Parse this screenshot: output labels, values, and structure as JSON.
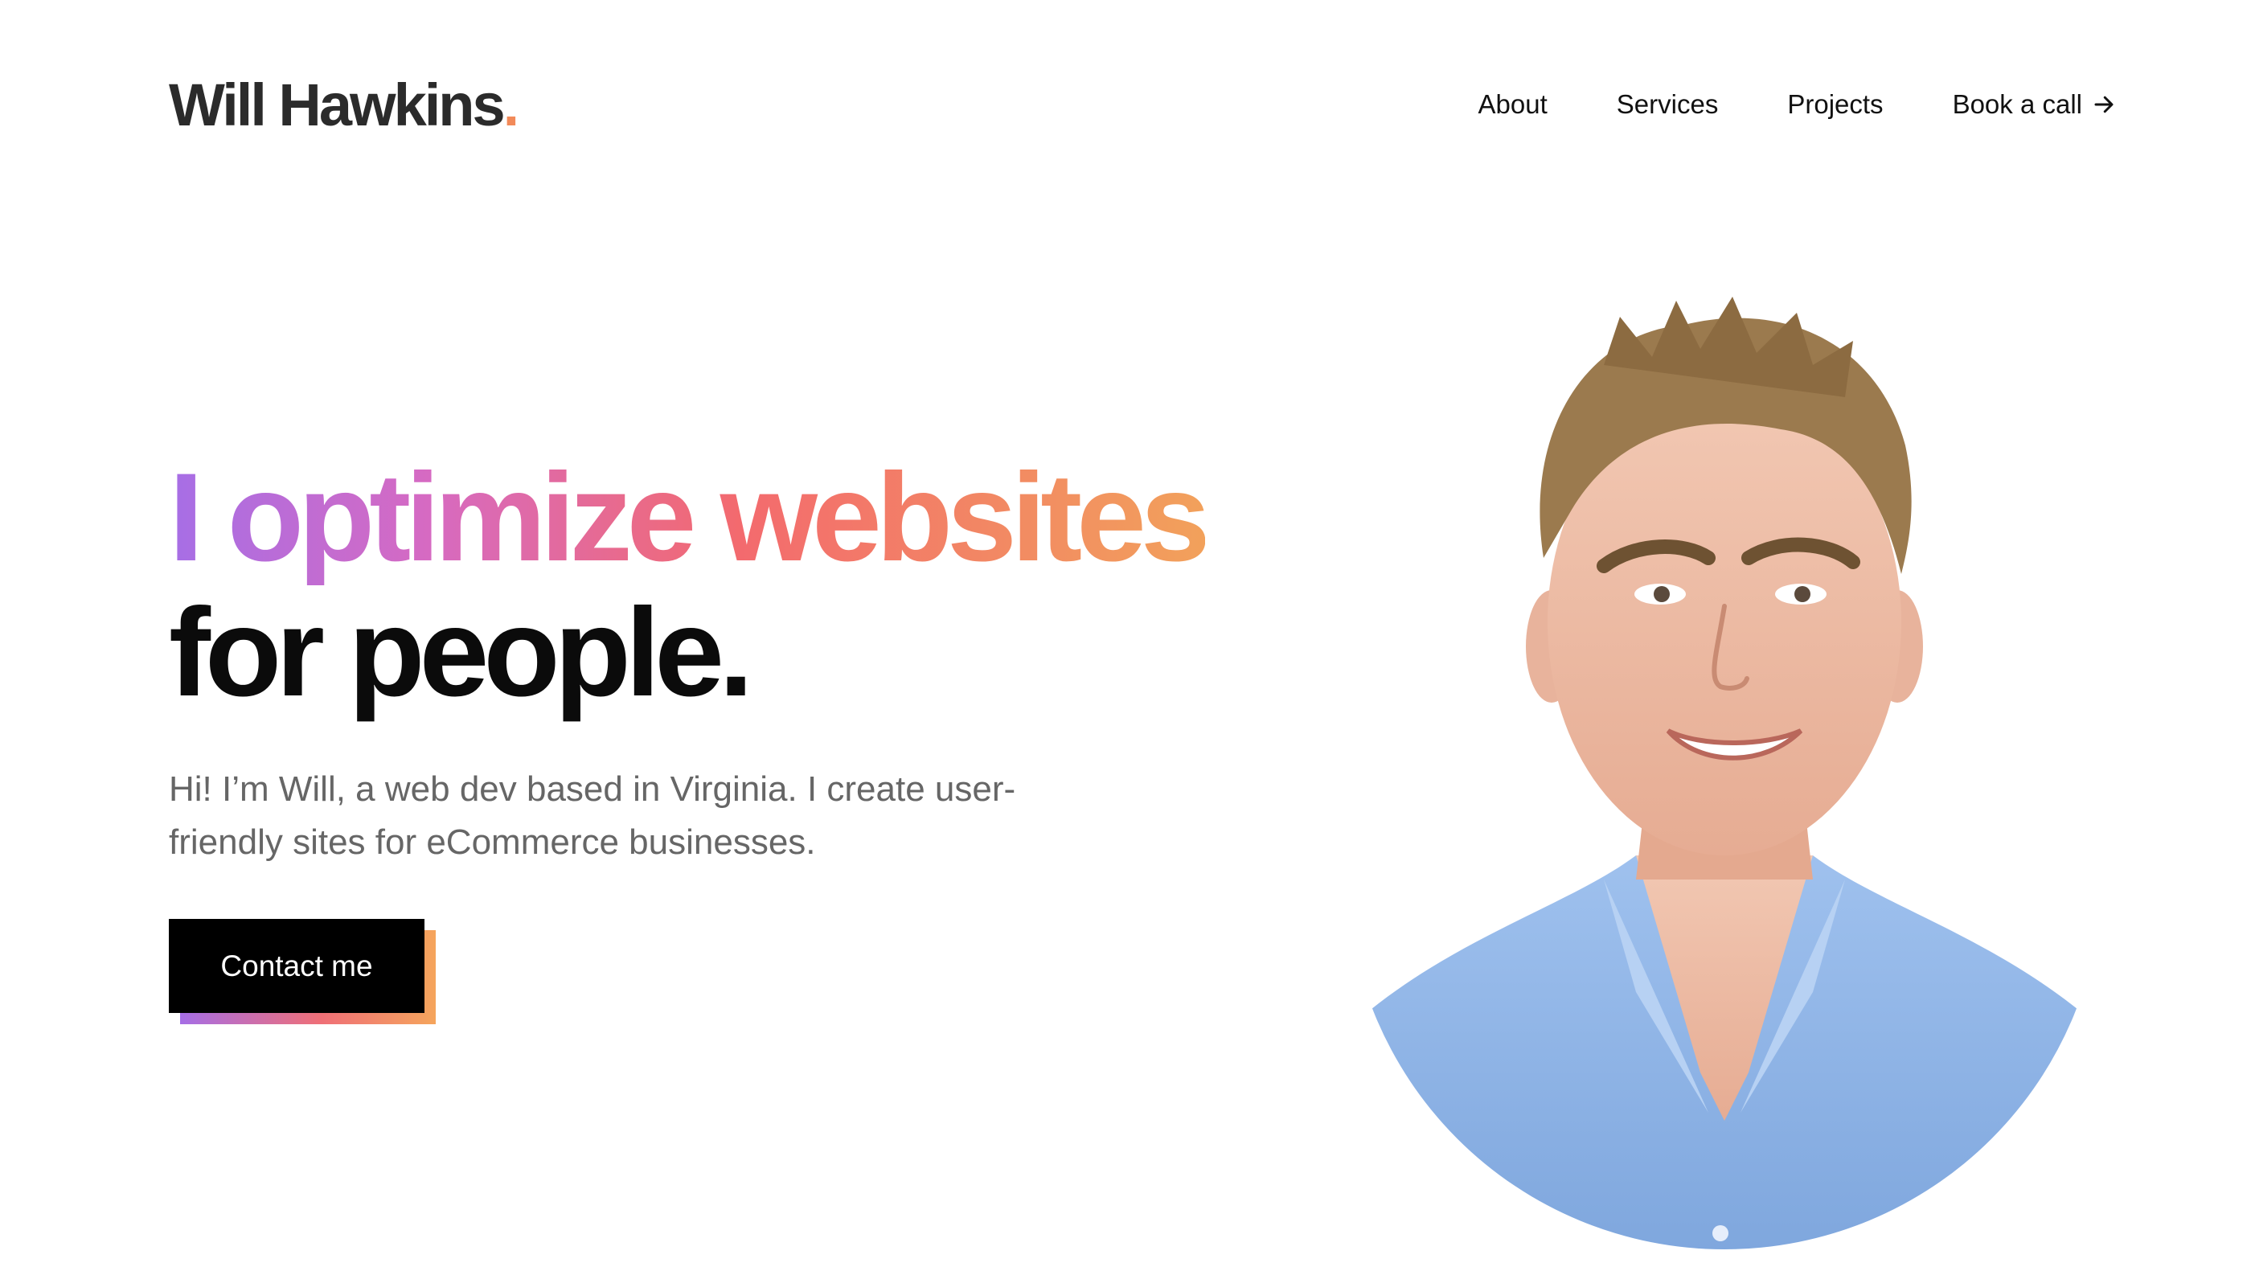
{
  "header": {
    "logo_text": "Will Hawkins",
    "logo_dot": "."
  },
  "nav": {
    "about": "About",
    "services": "Services",
    "projects": "Projects",
    "book_call": "Book a call",
    "book_call_icon": "arrow-right-icon"
  },
  "hero": {
    "headline_gradient": "I optimize websites",
    "headline_dark": "for people.",
    "intro": "Hi! I’m Will, a web dev based in Virginia. I create user-friendly sites for eCommerce businesses.",
    "cta_label": "Contact me"
  },
  "colors": {
    "gradient_start": "#a66ee6",
    "gradient_mid": "#f36a6e",
    "gradient_end": "#f2a15b",
    "accent_dot": "#f28a59",
    "text_dark": "#0b0b0b",
    "text_muted": "#666666"
  }
}
